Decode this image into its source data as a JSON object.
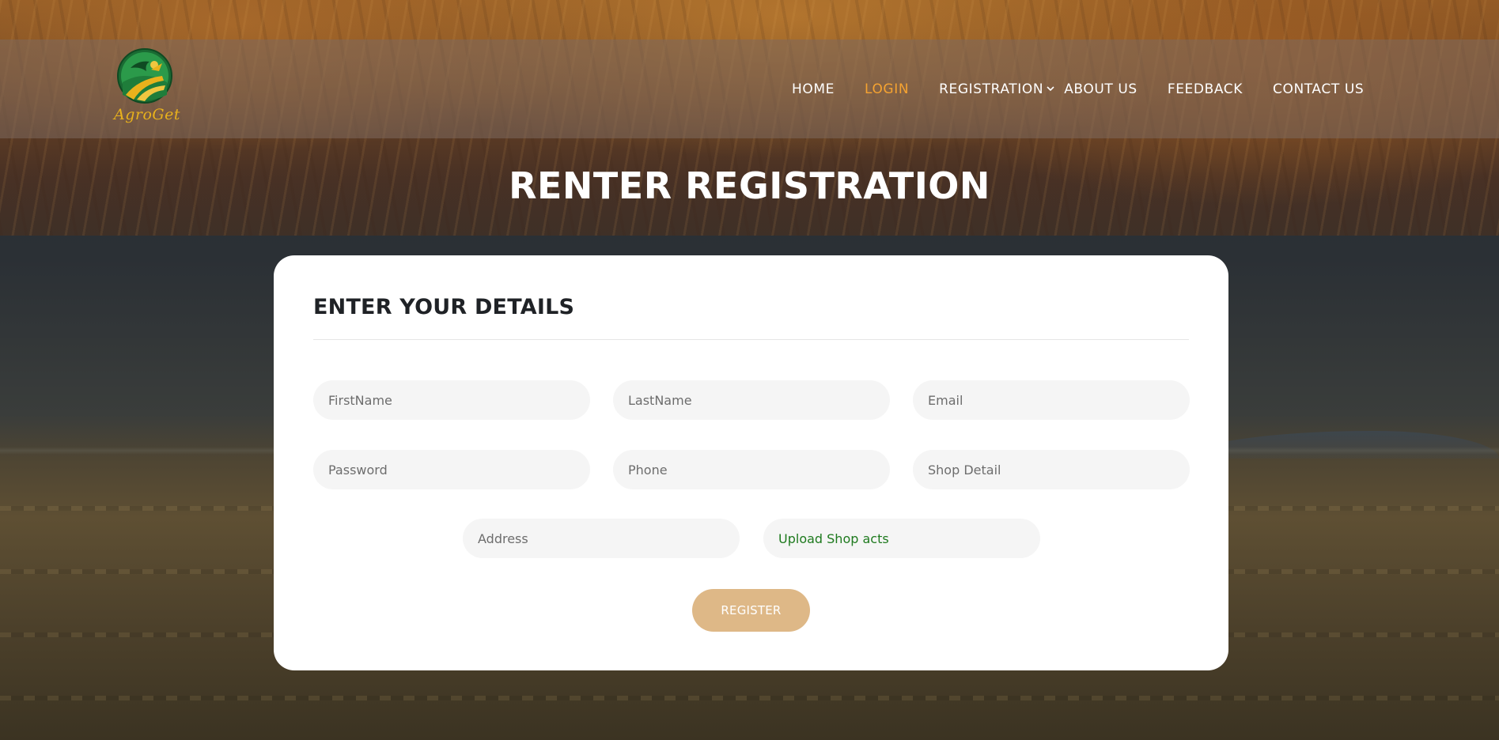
{
  "brand": {
    "name": "AgroGet"
  },
  "nav": {
    "items": [
      {
        "label": "HOME"
      },
      {
        "label": "LOGIN"
      },
      {
        "label": "REGISTRATION"
      },
      {
        "label": "ABOUT US"
      },
      {
        "label": "FEEDBACK"
      },
      {
        "label": "CONTACT US"
      }
    ],
    "active": "LOGIN"
  },
  "page": {
    "title": "RENTER REGISTRATION"
  },
  "form": {
    "heading": "ENTER YOUR DETAILS",
    "fields": {
      "first_name": {
        "placeholder": "FirstName",
        "value": ""
      },
      "last_name": {
        "placeholder": "LastName",
        "value": ""
      },
      "email": {
        "placeholder": "Email",
        "value": ""
      },
      "password": {
        "placeholder": "Password",
        "value": ""
      },
      "phone": {
        "placeholder": "Phone",
        "value": ""
      },
      "shop_detail": {
        "placeholder": "Shop Detail",
        "value": ""
      },
      "address": {
        "placeholder": "Address",
        "value": ""
      }
    },
    "upload_label": "Upload Shop acts",
    "submit_label": "REGISTER"
  },
  "colors": {
    "nav_active": "#f5a331",
    "logo_text": "#e9b21c",
    "upload_text": "#1e7a1e",
    "button_bg": "#deb887",
    "card_bg": "#ffffff",
    "field_bg": "#f5f5f5"
  }
}
